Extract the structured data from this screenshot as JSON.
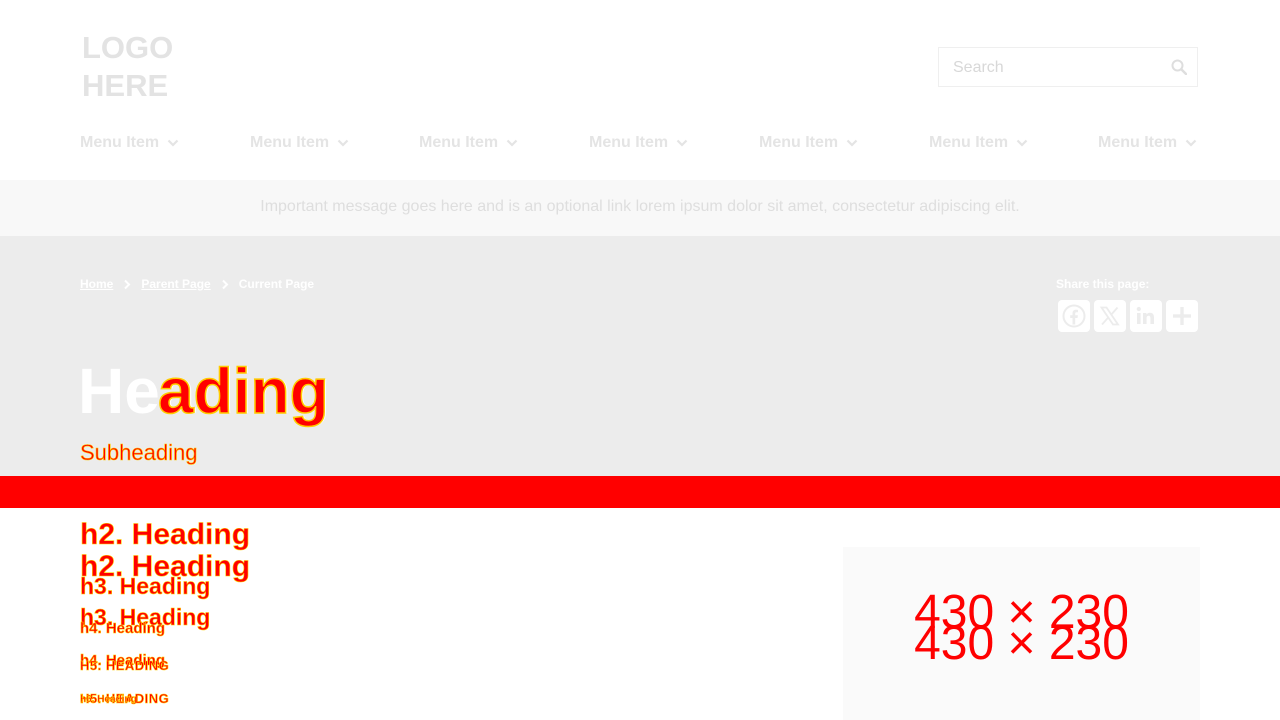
{
  "header": {
    "logo_line1": "LOGO",
    "logo_line2": "HERE",
    "search": {
      "placeholder": "Search"
    }
  },
  "nav": {
    "items": [
      {
        "label": "Menu Item"
      },
      {
        "label": "Menu Item"
      },
      {
        "label": "Menu Item"
      },
      {
        "label": "Menu Item"
      },
      {
        "label": "Menu Item"
      },
      {
        "label": "Menu Item"
      },
      {
        "label": "Menu Item"
      }
    ]
  },
  "alert": {
    "text": "Important message goes here and is an optional link lorem ipsum dolor sit amet, consectetur adipiscing elit."
  },
  "hero": {
    "breadcrumb": {
      "home": "Home",
      "parent": "Parent Page",
      "current": "Current Page"
    },
    "share_label": "Share this page:",
    "share_icons": [
      "facebook-icon",
      "x-icon",
      "linkedin-icon",
      "plus-icon"
    ],
    "title": "Heading",
    "title_overlay": "ading",
    "subheading": "Subheading"
  },
  "content": {
    "h2": "h2. Heading",
    "h3": "h3. Heading",
    "h4": "h4. Heading",
    "h5": "H5. HEADING",
    "h6": "h6. Heading",
    "image_placeholder": "430 × 230"
  },
  "colors": {
    "accent": "#ff0000",
    "highlight": "#ffcc00",
    "hero_bg": "#ececec",
    "alert_bg": "#f8f8f8"
  }
}
